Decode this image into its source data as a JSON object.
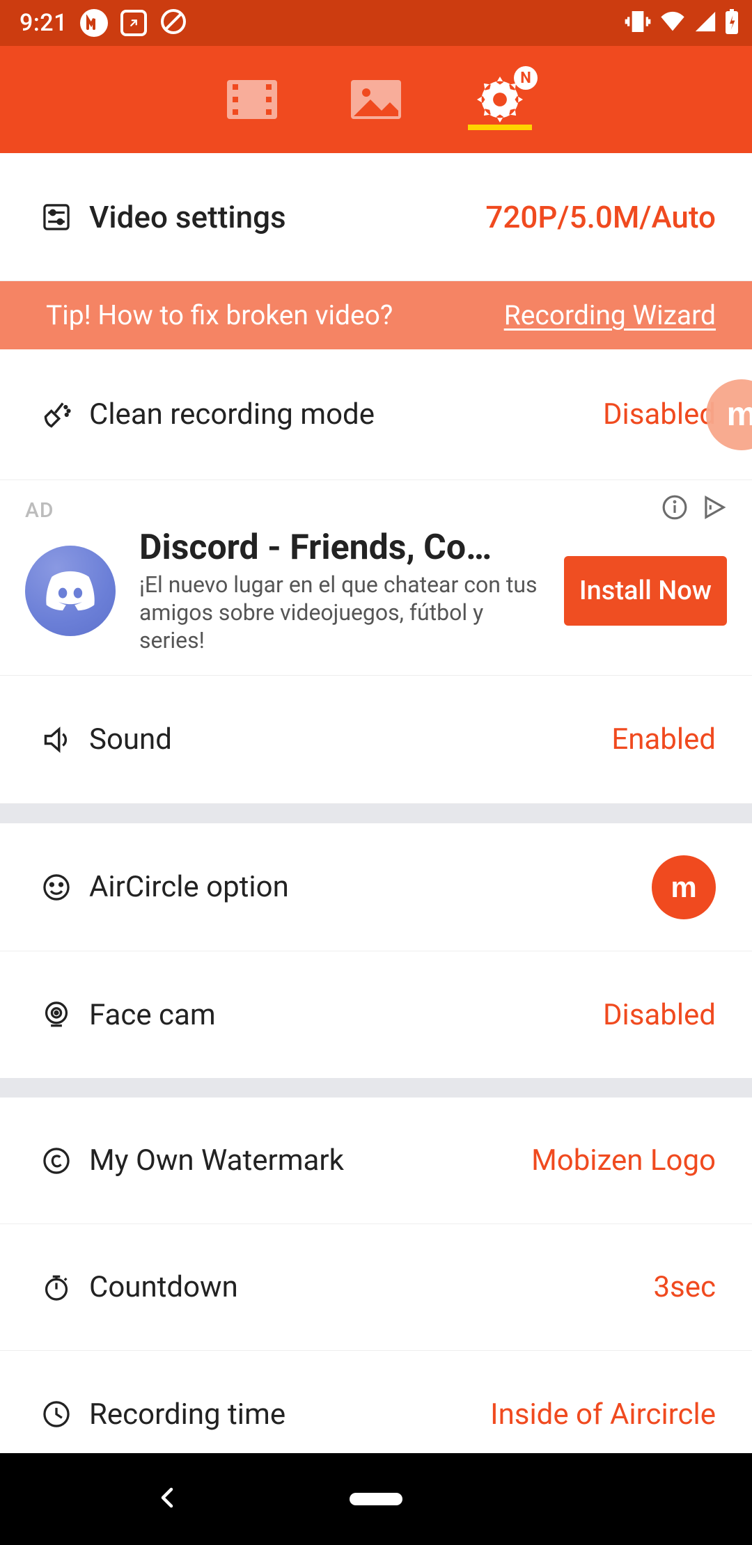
{
  "status": {
    "time": "9:21"
  },
  "tabs": {
    "badge": "N"
  },
  "settings": {
    "video": {
      "label": "Video settings",
      "value": "720P/5.0M/Auto"
    },
    "clean": {
      "label": "Clean recording mode",
      "value": "Disabled"
    },
    "sound": {
      "label": "Sound",
      "value": "Enabled"
    },
    "aircircle": {
      "label": "AirCircle option"
    },
    "facecam": {
      "label": "Face cam",
      "value": "Disabled"
    },
    "watermark": {
      "label": "My Own Watermark",
      "value": "Mobizen Logo"
    },
    "countdown": {
      "label": "Countdown",
      "value": "3sec"
    },
    "rectime": {
      "label": "Recording time",
      "value": "Inside of Aircircle"
    }
  },
  "tip": {
    "text": "Tip! How to fix broken video?",
    "link": "Recording Wizard"
  },
  "ad": {
    "tag": "AD",
    "title": "Discord - Friends, Co…",
    "subtitle": "¡El nuevo lugar en el que chatear con tus amigos sobre videojuegos, fútbol y series!",
    "cta": "Install Now"
  },
  "logo": {
    "m": "m"
  }
}
